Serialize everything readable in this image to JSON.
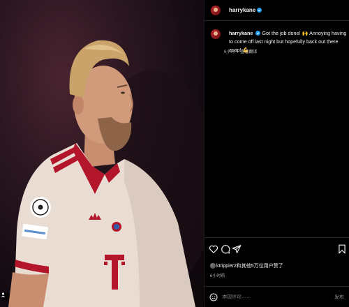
{
  "post": {
    "username": "harrykane",
    "caption_text": "Got the job done! 🙌 Annoying having to come off last night but hopefully back out there asap! 💪",
    "caption_age": "6小时",
    "see_translation": "查看翻译"
  },
  "likes": {
    "text": "ktrippier2和其他5万位用户赞了"
  },
  "timestamp": "6小时前",
  "comment": {
    "placeholder": "添加评论……",
    "post_label": "发布"
  },
  "icons": [
    "heart-icon",
    "comment-icon",
    "share-icon",
    "bookmark-icon",
    "emoji-icon",
    "verified-icon",
    "tag-user-icon"
  ],
  "colors": {
    "verified": "#1d9bf0",
    "background": "#000000",
    "kit": "#e9dcd2",
    "trim": "#b3162b"
  }
}
